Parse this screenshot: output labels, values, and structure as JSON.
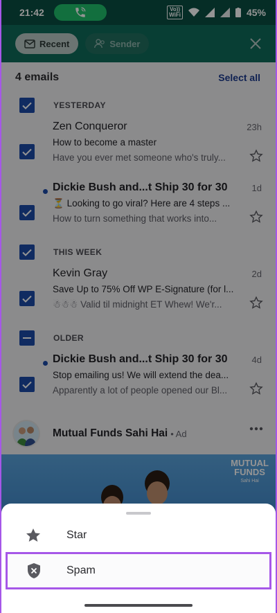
{
  "status_bar": {
    "time": "21:42",
    "volte_line1": "Vo))",
    "volte_line2": "WiFi",
    "battery": "45%"
  },
  "header": {
    "recent_chip": "Recent",
    "sender_chip": "Sender"
  },
  "list": {
    "count": "4 emails",
    "select_all": "Select all",
    "sections": [
      {
        "label": "YESTERDAY"
      },
      {
        "label": "THIS WEEK"
      },
      {
        "label": "OLDER"
      }
    ],
    "emails": [
      {
        "sender": "Zen Conqueror",
        "time": "23h",
        "subject": "How to become a master",
        "preview": "Have you ever met someone who's truly..."
      },
      {
        "sender": "Dickie Bush and...t Ship 30 for 30",
        "time": "1d",
        "subject": "Looking to go viral? Here are 4 steps ...",
        "preview": "How to turn something that works into..."
      },
      {
        "sender": "Kevin Gray",
        "time": "2d",
        "subject": "Save Up to 75% Off WP E-Signature (for l...",
        "preview": "Valid til midnight ET Whew! We'r..."
      },
      {
        "sender": "Dickie Bush and...t Ship 30 for 30",
        "time": "4d",
        "subject": "Stop emailing us! We will extend the dea...",
        "preview": "Apparently a lot of people opened our Bl..."
      }
    ]
  },
  "ad": {
    "name": "Mutual Funds Sahi Hai",
    "badge": "• Ad",
    "banner_line1": "MUTUAL",
    "banner_line2": "FUNDS",
    "banner_sub": "Sahi Hai"
  },
  "sheet": {
    "star_label": "Star",
    "spam_label": "Spam"
  },
  "colors": {
    "accent": "#1d4ba8",
    "header": "#0f6b5b",
    "highlight": "#a657e8"
  }
}
